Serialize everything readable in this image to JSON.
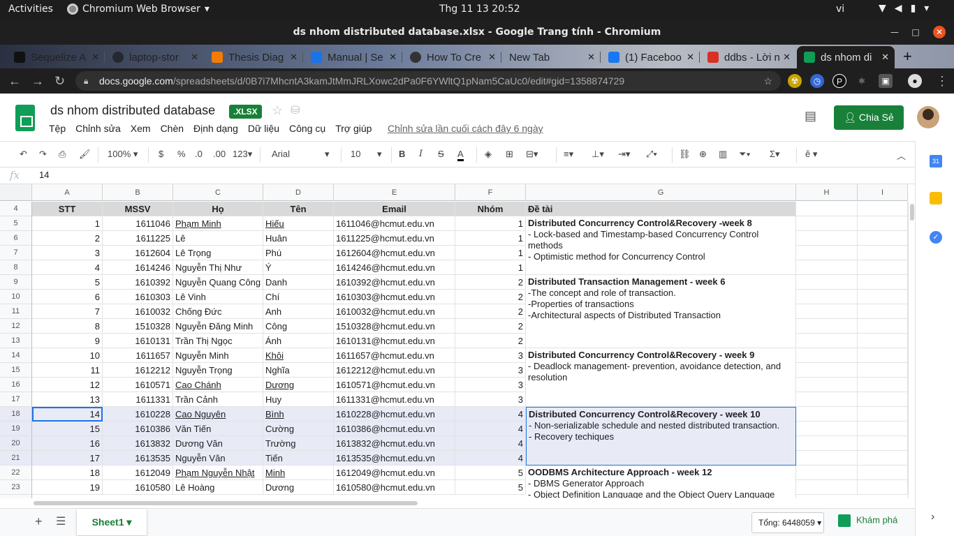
{
  "os": {
    "activities": "Activities",
    "app_name": "Chromium Web Browser",
    "clock": "Thg 11 13  20:52",
    "lang": "vi"
  },
  "window": {
    "title": "ds nhom distributed database.xlsx - Google Trang tính - Chromium"
  },
  "tabs": [
    {
      "label": "Sequelize A",
      "color": "#111111"
    },
    {
      "label": "laptop-stor",
      "color": "#24292e"
    },
    {
      "label": "Thesis Diag",
      "color": "#f57c00"
    },
    {
      "label": "Manual | Se",
      "color": "#1a73e8"
    },
    {
      "label": "How To Cre",
      "color": "#333333"
    },
    {
      "label": "New Tab",
      "color": ""
    },
    {
      "label": "(1) Faceboo",
      "color": "#1877f2"
    },
    {
      "label": "ddbs - Lời n",
      "color": "#d93025"
    },
    {
      "label": "ds nhom di",
      "color": "#0f9d58"
    }
  ],
  "url": {
    "host": "docs.google.com",
    "path": "/spreadsheets/d/0B7i7MhcntA3kamJtMmJRLXowc2dPa0F6YWltQ1pNam5CaUc0/edit#gid=1358874729"
  },
  "doc": {
    "title": "ds nhom distributed database",
    "badge": ".XLSX",
    "menus": [
      "Tệp",
      "Chỉnh sửa",
      "Xem",
      "Chèn",
      "Định dạng",
      "Dữ liệu",
      "Công cụ",
      "Trợ giúp"
    ],
    "last_edit": "Chỉnh sửa lần cuối cách đây 6 ngày",
    "share": "Chia Sẻ"
  },
  "toolbar": {
    "zoom": "100%",
    "currency": "$",
    "percent": "%",
    "dec_less": ".0",
    "dec_more": ".00",
    "more_formats": "123",
    "font": "Arial",
    "size": "10"
  },
  "formula": {
    "value": "14"
  },
  "columns": [
    "A",
    "B",
    "C",
    "D",
    "E",
    "F",
    "G",
    "H",
    "I"
  ],
  "header_row": {
    "row": "4",
    "stt": "STT",
    "mssv": "MSSV",
    "ho": "Họ",
    "ten": "Tên",
    "email": "Email",
    "nhom": "Nhóm",
    "detai": "Đề tài"
  },
  "rows": [
    {
      "r": "5",
      "stt": "1",
      "mssv": "1611046",
      "ho": "Phạm Minh",
      "ten": "Hiếu",
      "email": "1611046@hcmut.edu.vn",
      "nhom": "1"
    },
    {
      "r": "6",
      "stt": "2",
      "mssv": "1611225",
      "ho": "Lê",
      "ten": "Huân",
      "email": "1611225@hcmut.edu.vn",
      "nhom": "1"
    },
    {
      "r": "7",
      "stt": "3",
      "mssv": "1612604",
      "ho": "Lê Trọng",
      "ten": "Phú",
      "email": "1612604@hcmut.edu.vn",
      "nhom": "1"
    },
    {
      "r": "8",
      "stt": "4",
      "mssv": "1614246",
      "ho": "Nguyễn Thị Như",
      "ten": "Ý",
      "email": "1614246@hcmut.edu.vn",
      "nhom": "1"
    },
    {
      "r": "9",
      "stt": "5",
      "mssv": "1610392",
      "ho": "Nguyễn Quang Công",
      "ten": "Danh",
      "email": "1610392@hcmut.edu.vn",
      "nhom": "2"
    },
    {
      "r": "10",
      "stt": "6",
      "mssv": "1610303",
      "ho": "Lê Vinh",
      "ten": "Chí",
      "email": "1610303@hcmut.edu.vn",
      "nhom": "2"
    },
    {
      "r": "11",
      "stt": "7",
      "mssv": "1610032",
      "ho": "Chống Đức",
      "ten": "Anh",
      "email": "1610032@hcmut.edu.vn",
      "nhom": "2"
    },
    {
      "r": "12",
      "stt": "8",
      "mssv": "1510328",
      "ho": "Nguyễn Đăng Minh",
      "ten": "Công",
      "email": "1510328@hcmut.edu.vn",
      "nhom": "2"
    },
    {
      "r": "13",
      "stt": "9",
      "mssv": "1610131",
      "ho": "Trần Thị Ngọc",
      "ten": "Ánh",
      "email": "1610131@hcmut.edu.vn",
      "nhom": "2"
    },
    {
      "r": "14",
      "stt": "10",
      "mssv": "1611657",
      "ho": "Nguyễn Minh",
      "ten": "Khôi",
      "email": "1611657@hcmut.edu.vn",
      "nhom": "3"
    },
    {
      "r": "15",
      "stt": "11",
      "mssv": "1612212",
      "ho": "Nguyễn Trọng",
      "ten": "Nghĩa",
      "email": "1612212@hcmut.edu.vn",
      "nhom": "3"
    },
    {
      "r": "16",
      "stt": "12",
      "mssv": "1610571",
      "ho": "Cao Chánh",
      "ten": "Dương",
      "email": "1610571@hcmut.edu.vn",
      "nhom": "3"
    },
    {
      "r": "17",
      "stt": "13",
      "mssv": "1611331",
      "ho": "Trần Cảnh",
      "ten": "Huy",
      "email": "1611331@hcmut.edu.vn",
      "nhom": "3"
    },
    {
      "r": "18",
      "stt": "14",
      "mssv": "1610228",
      "ho": "Cao Nguyên",
      "ten": "Bình",
      "email": "1610228@hcmut.edu.vn",
      "nhom": "4"
    },
    {
      "r": "19",
      "stt": "15",
      "mssv": "1610386",
      "ho": "Văn Tiến",
      "ten": "Cường",
      "email": "1610386@hcmut.edu.vn",
      "nhom": "4"
    },
    {
      "r": "20",
      "stt": "16",
      "mssv": "1613832",
      "ho": "Dương Văn",
      "ten": "Trường",
      "email": "1613832@hcmut.edu.vn",
      "nhom": "4"
    },
    {
      "r": "21",
      "stt": "17",
      "mssv": "1613535",
      "ho": "Nguyễn Văn",
      "ten": "Tiến",
      "email": "1613535@hcmut.edu.vn",
      "nhom": "4"
    },
    {
      "r": "22",
      "stt": "18",
      "mssv": "1612049",
      "ho": "Phạm Nguyễn Nhật",
      "ten": "Minh",
      "email": "1612049@hcmut.edu.vn",
      "nhom": "5"
    },
    {
      "r": "23",
      "stt": "19",
      "mssv": "1610580",
      "ho": "Lê Hoàng",
      "ten": "Dương",
      "email": "1610580@hcmut.edu.vn",
      "nhom": "5"
    }
  ],
  "topics": [
    {
      "title": "Distributed Concurrency Control&Recovery -week 8",
      "lines": [
        "- Lock-based and Timestamp-based Concurrency Control methods",
        "- Optimistic method for Concurrency Control"
      ]
    },
    {
      "title": "Distributed Transaction Management - week 6",
      "lines": [
        "-The concept and role of transaction.",
        "-Properties of transactions",
        "-Architectural aspects of Distributed Transaction"
      ]
    },
    {
      "title": "Distributed Concurrency Control&Recovery - week 9",
      "lines": [
        "- Deadlock management- prevention, avoidance detection, and resolution"
      ]
    },
    {
      "title": "Distributed Concurrency Control&Recovery - week 10",
      "lines": [
        "- Non-serializable schedule and nested distributed transaction.",
        "- Recovery techiques"
      ]
    },
    {
      "title": "OODBMS Architecture Approach - week 12",
      "lines": [
        "- DBMS Generator Approach",
        "- Object Definition Language and the Object Query Language"
      ]
    }
  ],
  "bottom": {
    "sheet": "Sheet1",
    "sum": "Tổng: 6448059",
    "explore": "Khám phá"
  }
}
